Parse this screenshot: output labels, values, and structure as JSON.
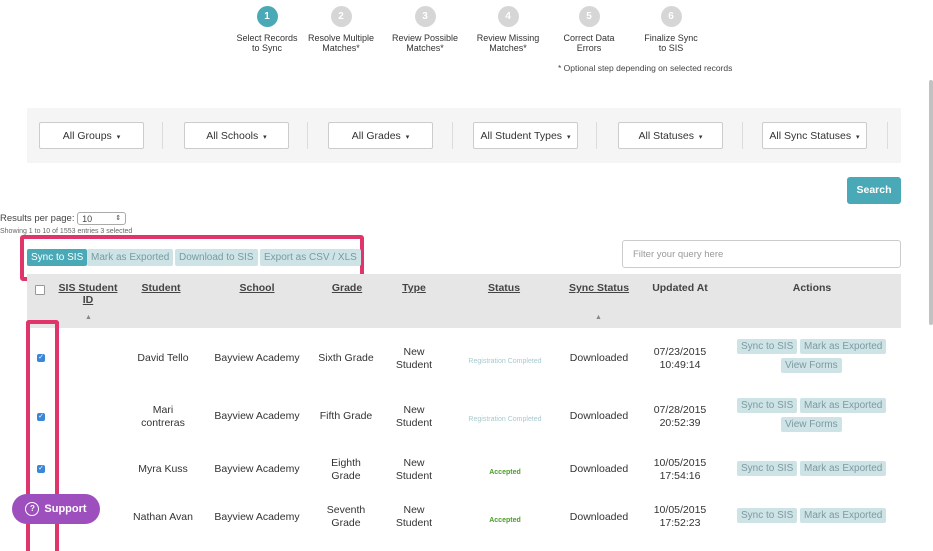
{
  "steps": [
    {
      "num": "1",
      "label": "Select Records\nto Sync",
      "active": true
    },
    {
      "num": "2",
      "label": "Resolve Multiple\nMatches*",
      "active": false
    },
    {
      "num": "3",
      "label": "Review Possible\nMatches*",
      "active": false
    },
    {
      "num": "4",
      "label": "Review Missing\nMatches*",
      "active": false
    },
    {
      "num": "5",
      "label": "Correct Data\nErrors",
      "active": false
    },
    {
      "num": "6",
      "label": "Finalize Sync\nto SIS",
      "active": false
    }
  ],
  "optional_note": "* Optional step depending on selected records",
  "filters": {
    "groups": "All Groups",
    "schools": "All Schools",
    "grades": "All Grades",
    "student_types": "All Student Types",
    "statuses": "All Statuses",
    "sync_statuses": "All Sync Statuses",
    "caret": "▾"
  },
  "search_label": "Search",
  "results_per_page": {
    "label": "Results per page:",
    "value": "10",
    "arrows": "⇕"
  },
  "showing": "Showing 1 to 10 of 1553 entries 3 selected",
  "bulk_actions": {
    "sync": "Sync to SIS",
    "mark": "Mark as Exported",
    "download": "Download to SIS",
    "export": "Export as CSV / XLS"
  },
  "filter_query_placeholder": "Filter your query here",
  "columns": {
    "sis_id": "SIS Student ID",
    "student": "Student",
    "school": "School",
    "grade": "Grade",
    "type": "Type",
    "status": "Status",
    "sync_status": "Sync Status",
    "updated_at": "Updated At",
    "actions": "Actions"
  },
  "sort_indicator": "▲",
  "check_glyph": "✓",
  "rows": [
    {
      "student": "David Tello",
      "school": "Bayview Academy",
      "grade": "Sixth Grade",
      "type": "New\nStudent",
      "status": "Registration Completed",
      "sync_status": "Downloaded",
      "updated": "07/23/2015\n10:49:14",
      "act_sync": "Sync to SIS",
      "act_mark": "Mark as Exported",
      "act_view": "View Forms"
    },
    {
      "student": "Mari\ncontreras",
      "school": "Bayview Academy",
      "grade": "Fifth Grade",
      "type": "New\nStudent",
      "status": "Registration Completed",
      "sync_status": "Downloaded",
      "updated": "07/28/2015\n20:52:39",
      "act_sync": "Sync to SIS",
      "act_mark": "Mark as Exported",
      "act_view": "View Forms"
    },
    {
      "student": "Myra Kuss",
      "school": "Bayview Academy",
      "grade": "Eighth\nGrade",
      "type": "New\nStudent",
      "status": "Accepted",
      "sync_status": "Downloaded",
      "updated": "10/05/2015\n17:54:16",
      "act_sync": "Sync to SIS",
      "act_mark": "Mark as Exported"
    },
    {
      "student": "Nathan Avan",
      "school": "Bayview Academy",
      "grade": "Seventh\nGrade",
      "type": "New\nStudent",
      "status": "Accepted",
      "sync_status": "Downloaded",
      "updated": "10/05/2015\n17:52:23",
      "act_sync": "Sync to SIS",
      "act_mark": "Mark as Exported"
    }
  ],
  "support_label": "Support",
  "support_glyph": "?",
  "colors": {
    "accent": "#4aa9b6",
    "highlight": "#e0356a",
    "support": "#9e4fbe",
    "accepted": "#4d9d2a"
  }
}
